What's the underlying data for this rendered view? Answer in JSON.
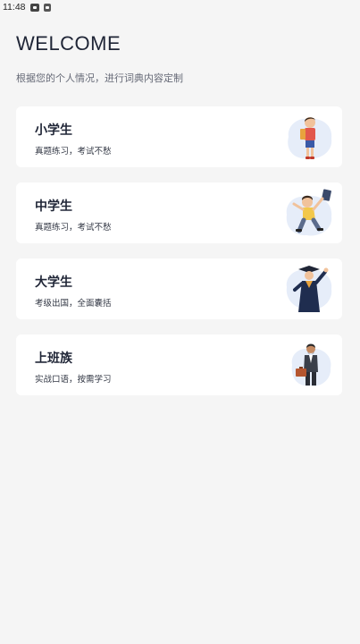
{
  "status_bar": {
    "time": "11:48"
  },
  "header": {
    "title": "WELCOME",
    "subtitle": "根据您的个人情况，进行词典内容定制"
  },
  "options": [
    {
      "title": "小学生",
      "desc": "真题练习，考试不愁",
      "illustration": "elementary-student"
    },
    {
      "title": "中学生",
      "desc": "真题练习，考试不愁",
      "illustration": "middle-school-student"
    },
    {
      "title": "大学生",
      "desc": "考级出国，全面囊括",
      "illustration": "college-graduate"
    },
    {
      "title": "上班族",
      "desc": "实战口语，按需学习",
      "illustration": "office-worker"
    }
  ],
  "colors": {
    "background": "#f5f5f5",
    "card": "#ffffff",
    "text": "#1f2536",
    "blob": "#e6edf9"
  }
}
